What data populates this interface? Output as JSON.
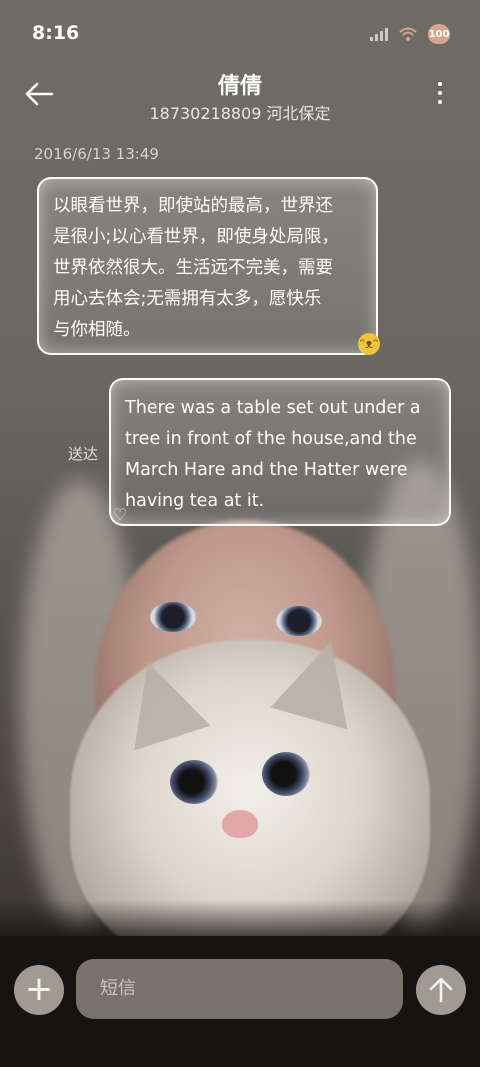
{
  "status_bar": {
    "time": "8:16",
    "battery_level": "100"
  },
  "header": {
    "contact_name": "倩倩",
    "contact_info": "18730218809 河北保定"
  },
  "messages": {
    "timestamp": "2016/6/13 13:49",
    "incoming": {
      "lines": [
        "以眼看世界，即使站的最高，世界还",
        "是很小;以心看世界，即使身处局限，",
        "世界依然很大。生活远不完美，需要",
        "用心去体会;无需拥有太多，愿快乐",
        "与你相随。"
      ],
      "sticker": "cat-emoji"
    },
    "outgoing": {
      "lines": [
        "There was a table set out under a",
        "tree in front of the house,and the",
        "March Hare and the Hatter were",
        "having tea at it."
      ],
      "status": "送达",
      "sticker": "heart-emoji"
    }
  },
  "composer": {
    "placeholder": "短信",
    "add_icon": "plus-icon",
    "send_icon": "arrow-up-icon"
  },
  "colors": {
    "input_bar_bg": "#161413",
    "button_bg": "#a19a92",
    "input_bg": "#78726c"
  }
}
